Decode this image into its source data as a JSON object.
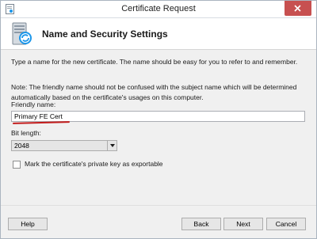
{
  "window": {
    "title": "Certificate Request"
  },
  "header": {
    "title": "Name and Security Settings"
  },
  "main": {
    "description": "Type a name for the new certificate. The name should be easy for you to refer to and remember.",
    "note": "Note: The friendly name should not be confused with the subject name which will be determined automatically based on the certificate's usages on this computer.",
    "friendly_name": {
      "label": "Friendly name:",
      "value": "Primary FE Cert"
    },
    "bit_length": {
      "label": "Bit length:",
      "value": "2048"
    },
    "exportable": {
      "label": "Mark the certificate's private key as exportable",
      "checked": false
    }
  },
  "footer": {
    "help": "Help",
    "back": "Back",
    "next": "Next",
    "cancel": "Cancel"
  },
  "colors": {
    "close": "#c75050",
    "underline": "#c21b1b",
    "accent": "#1c97ea"
  }
}
